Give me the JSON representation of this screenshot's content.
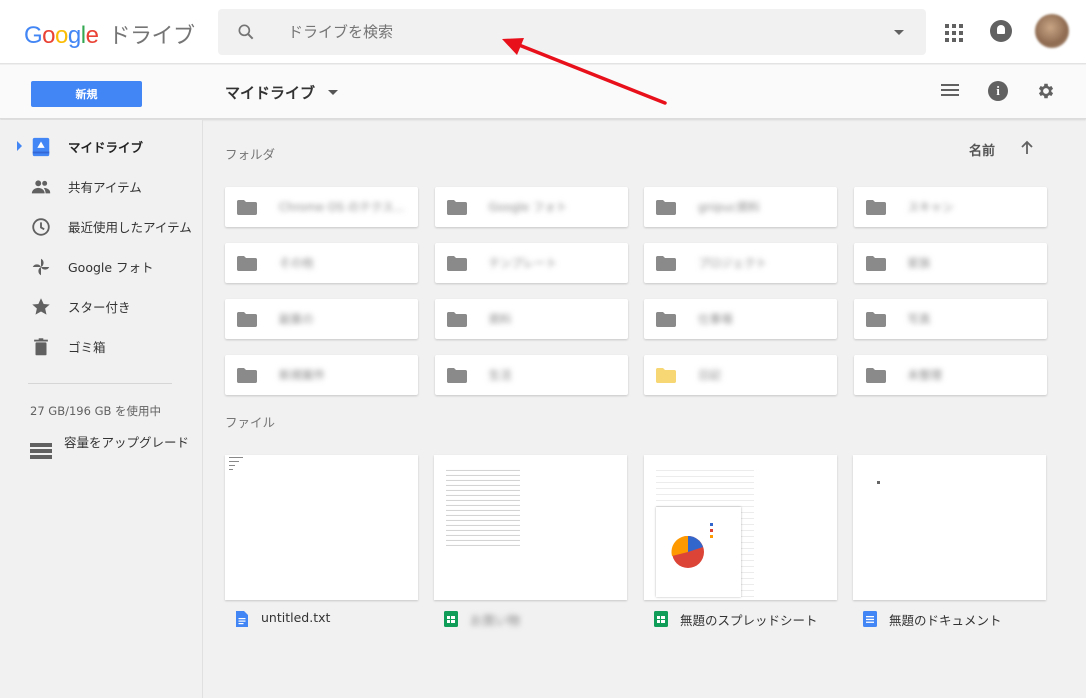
{
  "header": {
    "logo": "Google",
    "product": "ドライブ",
    "search_placeholder": "ドライブを検索",
    "icons": [
      "search-icon",
      "apps-icon",
      "notifications-icon",
      "avatar"
    ]
  },
  "toolbar": {
    "new_label": "新規",
    "title": "マイドライブ"
  },
  "sidebar": {
    "items": [
      {
        "label": "マイドライブ",
        "icon": "my-drive-icon",
        "active": true
      },
      {
        "label": "共有アイテム",
        "icon": "shared-icon"
      },
      {
        "label": "最近使用したアイテム",
        "icon": "recent-icon"
      },
      {
        "label": "Google フォト",
        "icon": "photos-icon"
      },
      {
        "label": "スター付き",
        "icon": "star-icon"
      },
      {
        "label": "ゴミ箱",
        "icon": "trash-icon"
      }
    ],
    "storage": "27 GB/196 GB を使用中",
    "upgrade": "容量をアップグレード"
  },
  "main": {
    "folders_label": "フォルダ",
    "files_label": "ファイル",
    "sort_label": "名前",
    "folders": [
      {
        "name": "Chrome OS のテクス...",
        "color": "#8a8a8a"
      },
      {
        "name": "Google フォト",
        "color": "#8a8a8a"
      },
      {
        "name": "gnipuc資料",
        "color": "#8a8a8a"
      },
      {
        "name": "スキャン",
        "color": "#8a8a8a"
      },
      {
        "name": "その他",
        "color": "#8a8a8a"
      },
      {
        "name": "テンプレート",
        "color": "#8a8a8a"
      },
      {
        "name": "プロジェクト",
        "color": "#8a8a8a"
      },
      {
        "name": "家族",
        "color": "#8a8a8a"
      },
      {
        "name": "副業の",
        "color": "#8a8a8a"
      },
      {
        "name": "資料",
        "color": "#8a8a8a"
      },
      {
        "name": "仕事場",
        "color": "#8a8a8a"
      },
      {
        "name": "写真",
        "color": "#8a8a8a"
      },
      {
        "name": "新規案件",
        "color": "#8a8a8a"
      },
      {
        "name": "生活",
        "color": "#8a8a8a"
      },
      {
        "name": "日記",
        "color": "#f7d774"
      },
      {
        "name": "未整理",
        "color": "#8a8a8a"
      }
    ],
    "files": [
      {
        "name": "untitled.txt",
        "type": "doc",
        "blurred": false
      },
      {
        "name": "お買い物",
        "type": "sheet",
        "blurred": true
      },
      {
        "name": "無題のスプレッドシート",
        "type": "sheet",
        "blurred": false
      },
      {
        "name": "無題のドキュメント",
        "type": "doc",
        "blurred": false
      }
    ]
  },
  "colors": {
    "accent": "#4285f4",
    "sheets_green": "#0f9d58",
    "docs_blue": "#4285f4",
    "annotation_red": "#e8101a"
  }
}
